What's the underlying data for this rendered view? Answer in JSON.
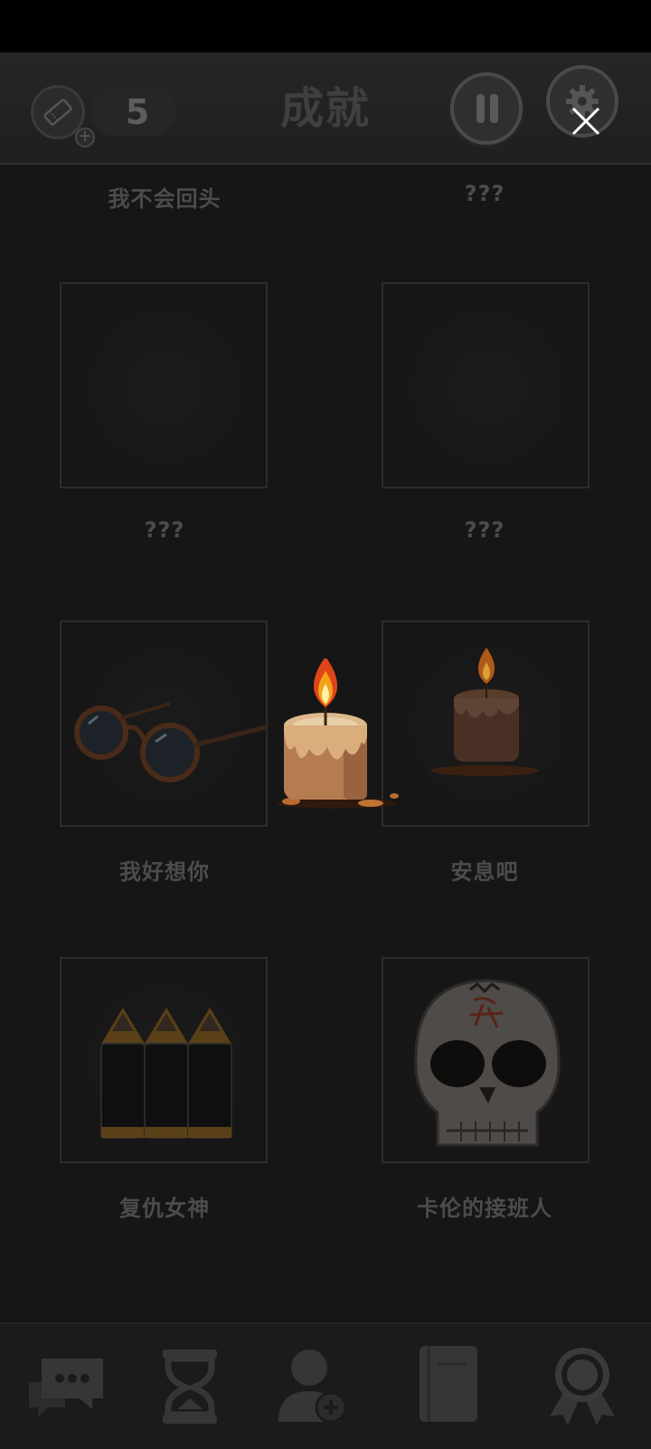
{
  "header": {
    "title": "成就",
    "ticket_count": "5"
  },
  "achievements": [
    {
      "label": "我不会回头",
      "locked": false
    },
    {
      "label": "???",
      "locked": true
    },
    {
      "label": "???",
      "locked": true
    },
    {
      "label": "???",
      "locked": true
    },
    {
      "label": "我好想你",
      "locked": false,
      "icon": "glasses-icon"
    },
    {
      "label": "安息吧",
      "locked": false,
      "icon": "candle-icon"
    },
    {
      "label": "复仇女神",
      "locked": false,
      "icon": "bullets-icon"
    },
    {
      "label": "卡伦的接班人",
      "locked": false,
      "icon": "skull-mask-icon"
    }
  ],
  "bottom_nav": [
    {
      "icon": "chat-bubbles-icon"
    },
    {
      "icon": "hourglass-icon"
    },
    {
      "icon": "add-contact-icon"
    },
    {
      "icon": "book-icon"
    },
    {
      "icon": "award-badge-icon"
    }
  ],
  "colors": {
    "background": "#161616",
    "header": "#232323",
    "text_dim": "#4c4c4c",
    "candle_flame": "#f4a21a"
  }
}
